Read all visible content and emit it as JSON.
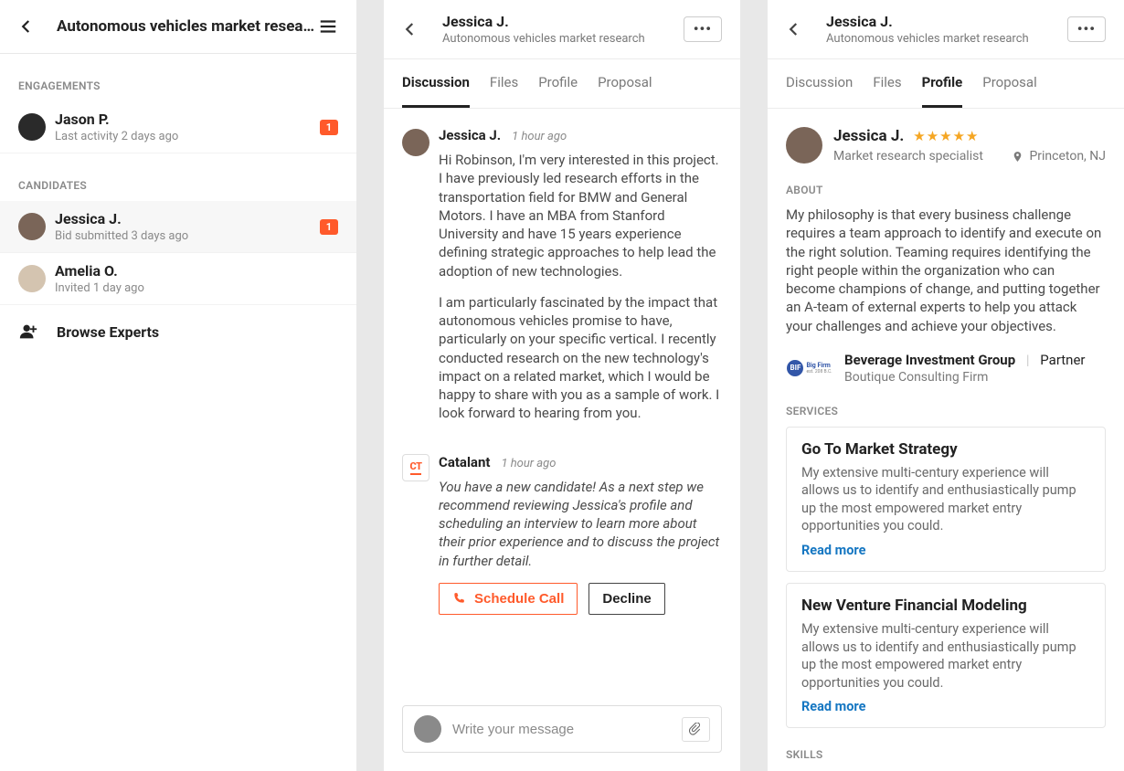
{
  "left": {
    "title": "Autonomous vehicles market resear...",
    "section_engagements": "ENGAGEMENTS",
    "section_candidates": "CANDIDATES",
    "engagements": [
      {
        "name": "Jason P.",
        "sub": "Last activity 2 days ago",
        "badge": "1"
      }
    ],
    "candidates": [
      {
        "name": "Jessica J.",
        "sub": "Bid submitted 3 days ago",
        "badge": "1",
        "selected": true
      },
      {
        "name": "Amelia O.",
        "sub": "Invited 1 day ago"
      }
    ],
    "browse": "Browse Experts"
  },
  "middle": {
    "header": {
      "name": "Jessica J.",
      "sub": "Autonomous vehicles market research"
    },
    "tabs": [
      "Discussion",
      "Files",
      "Profile",
      "Proposal"
    ],
    "active_tab": "Discussion",
    "messages": [
      {
        "author": "Jessica J.",
        "time": "1 hour ago",
        "paragraphs": [
          "Hi Robinson, I'm very interested in this project. I have previously led research efforts in the transportation field for BMW and General Motors. I have an MBA from Stanford University and have 15 years experience defining strategic approaches to help lead the adoption of new technologies.",
          "I am particularly fascinated by the impact that autonomous vehicles promise to have, particularly on your specific vertical. I recently conducted research on the new technology's impact on a related market, which I would be happy to share with you as a sample of work. I look forward to hearing from you."
        ]
      },
      {
        "author": "Catalant",
        "time": "1 hour ago",
        "system": true,
        "paragraphs": [
          "You have a new candidate! As a next step we recommend reviewing Jessica's profile and scheduling an interview to learn more about their prior experience and to discuss the project in further detail."
        ]
      }
    ],
    "actions": {
      "schedule": "Schedule Call",
      "decline": "Decline"
    },
    "compose_placeholder": "Write your message"
  },
  "right": {
    "header": {
      "name": "Jessica J.",
      "sub": "Autonomous vehicles market research"
    },
    "tabs": [
      "Discussion",
      "Files",
      "Profile",
      "Proposal"
    ],
    "active_tab": "Profile",
    "profile": {
      "name": "Jessica J.",
      "stars": "★★★★★",
      "role": "Market research specialist",
      "location": "Princeton, NJ"
    },
    "about_label": "ABOUT",
    "about": "My philosophy is that every business challenge requires a team approach to identify and execute on the right solution.  Teaming requires identifying the right people within the organization who can become champions of change, and putting together an A-team of external experts to help you attack your challenges and achieve your objectives.",
    "employer": {
      "logo_text": "BIF",
      "logo_brand": "Big Firm",
      "logo_sub": "est. 208 B.C.",
      "name": "Beverage Investment Group",
      "role": "Partner",
      "type": "Boutique Consulting Firm"
    },
    "services_label": "SERVICES",
    "services": [
      {
        "title": "Go To Market Strategy",
        "desc": "My extensive multi-century experience will allows us to identify and enthusiastically pump up the most empowered market entry opportunities you could.",
        "more": "Read more"
      },
      {
        "title": "New Venture Financial Modeling",
        "desc": "My extensive multi-century experience will allows us to identify and enthusiastically pump up the most empowered market entry opportunities you could.",
        "more": "Read more"
      }
    ],
    "skills_label": "SKILLS"
  }
}
